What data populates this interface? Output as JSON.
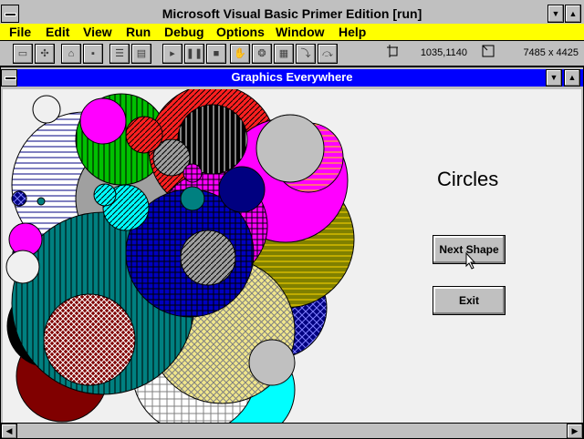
{
  "app": {
    "title": "Microsoft Visual Basic Primer Edition [run]",
    "menu": [
      "File",
      "Edit",
      "View",
      "Run",
      "Debug",
      "Options",
      "Window",
      "Help"
    ],
    "position_readout": "1035,1140",
    "size_readout": "7485 x 4425"
  },
  "form": {
    "title": "Graphics Everywhere",
    "shape_label": "Circles",
    "next_button": "Next Shape",
    "exit_button": "Exit"
  },
  "icons": {
    "toolbar": [
      "form-icon",
      "module-icon",
      "open-icon",
      "save-icon",
      "properties-icon",
      "menu-design-icon",
      "run-icon",
      "pause-icon",
      "stop-icon",
      "breakpoint-icon",
      "instant-watch-icon",
      "calls-icon",
      "single-step-icon",
      "procedure-step-icon"
    ],
    "window": [
      "system-menu-icon",
      "minimize-icon",
      "maximize-icon"
    ]
  },
  "colors": {
    "menubar": "#ffff00",
    "child_title": "#0000ff",
    "canvas": "#f0f0f0"
  }
}
